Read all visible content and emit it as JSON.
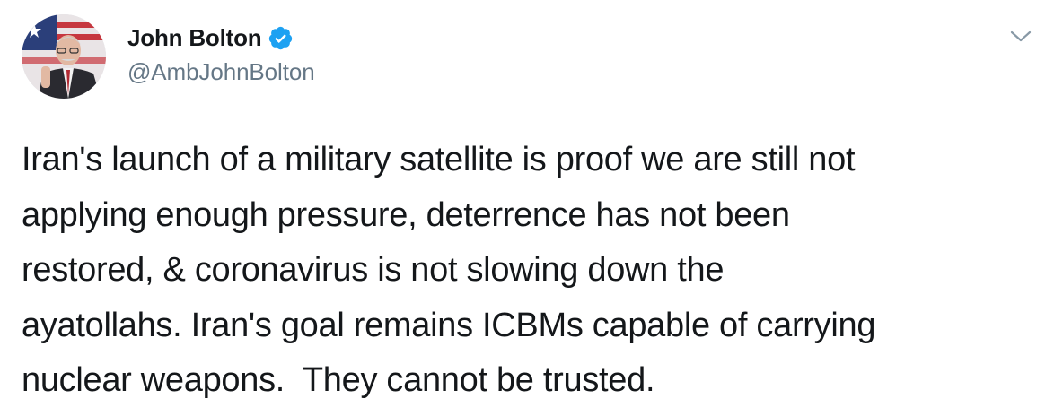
{
  "author": {
    "display_name": "John Bolton",
    "handle": "@AmbJohnBolton",
    "verified": true,
    "verified_color": "#1da1f2"
  },
  "icons": {
    "verified": "verified-badge-icon",
    "menu": "chevron-down-icon"
  },
  "tweet": {
    "lines": [
      "Iran's launch of a military satellite is proof we are still not",
      "applying enough pressure, deterrence has not been",
      "restored, & coronavirus is not slowing down the",
      "ayatollahs. Iran's goal remains ICBMs capable of carrying",
      "nuclear weapons.  They cannot be trusted."
    ]
  },
  "colors": {
    "text": "#14171a",
    "secondary_text": "#657786",
    "background": "#ffffff"
  }
}
